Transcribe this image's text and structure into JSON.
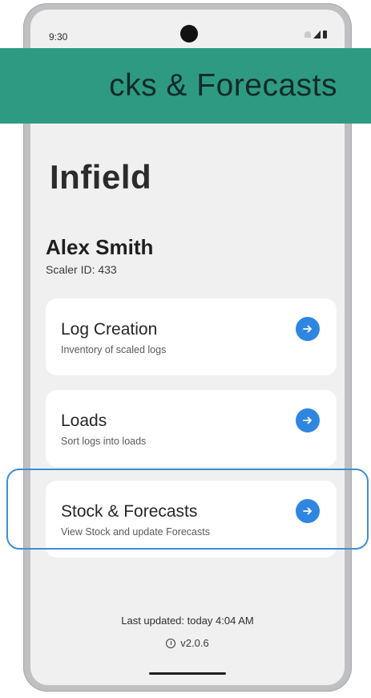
{
  "status_bar": {
    "time": "9:30",
    "icons": [
      "wifi-icon",
      "signal-icon",
      "battery-icon"
    ]
  },
  "banner": {
    "text": "cks & Forecasts",
    "background": "#2f9a82",
    "text_color": "#0f2b2a"
  },
  "app": {
    "title": "Infield"
  },
  "user": {
    "name": "Alex Smith",
    "scaler_id": "Scaler ID: 433"
  },
  "menu": {
    "items": [
      {
        "title": "Log Creation",
        "subtitle": "Inventory of scaled logs",
        "icon": "arrow-right-icon"
      },
      {
        "title": "Loads",
        "subtitle": "Sort logs into loads",
        "icon": "arrow-right-icon"
      },
      {
        "title": "Stock & Forecasts",
        "subtitle": "View Stock and update Forecasts",
        "icon": "arrow-right-icon",
        "highlighted": true
      }
    ]
  },
  "footer": {
    "last_updated": "Last updated: today 4:04 AM",
    "version": "v2.0.6",
    "version_icon": "info-icon"
  },
  "colors": {
    "accent_blue": "#2f86e0",
    "highlight_border": "#3d8ed8",
    "screen_bg": "#f0f0f1",
    "card_bg": "#ffffff"
  }
}
